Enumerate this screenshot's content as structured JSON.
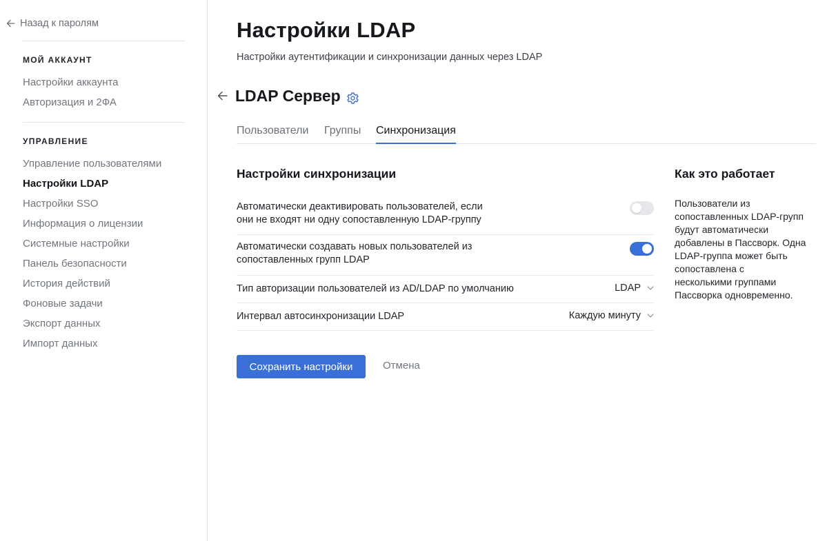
{
  "sidebar": {
    "back_label": "Назад к паролям",
    "sections": [
      {
        "title": "МОЙ АККАУНТ",
        "items": [
          {
            "label": "Настройки аккаунта"
          },
          {
            "label": "Авторизация и 2ФА"
          }
        ]
      },
      {
        "title": "УПРАВЛЕНИЕ",
        "items": [
          {
            "label": "Управление пользователями"
          },
          {
            "label": "Настройки LDAP",
            "active": true
          },
          {
            "label": "Настройки SSO"
          },
          {
            "label": "Информация о лицензии"
          },
          {
            "label": "Системные настройки"
          },
          {
            "label": "Панель безопасности"
          },
          {
            "label": "История действий"
          },
          {
            "label": "Фоновые задачи"
          },
          {
            "label": "Экспорт данных"
          },
          {
            "label": "Импорт данных"
          }
        ]
      }
    ]
  },
  "header": {
    "title": "Настройки LDAP",
    "subtitle": "Настройки аутентификации и синхронизации данных через LDAP"
  },
  "server": {
    "title": "LDAP Сервер",
    "back_icon": "arrow-left-icon",
    "settings_icon": "gear-icon"
  },
  "tabs": [
    {
      "label": "Пользователи"
    },
    {
      "label": "Группы"
    },
    {
      "label": "Синхронизация",
      "active": true
    }
  ],
  "sync": {
    "title": "Настройки синхронизации",
    "settings": [
      {
        "label_line1": "Автоматически деактивировать пользователей, если",
        "label_line2": "они не входят ни одну сопоставленную LDAP-группу",
        "control": "toggle",
        "enabled": false
      },
      {
        "label_line1": "Автоматически создавать новых пользователей из",
        "label_line2": "сопоставленных групп LDAP",
        "control": "toggle",
        "enabled": true
      },
      {
        "label": "Тип авторизации пользователей из AD/LDAP по умолчанию",
        "control": "select",
        "value": "LDAP"
      },
      {
        "label": "Интервал автосинхронизации LDAP",
        "control": "select",
        "value": "Каждую минуту"
      }
    ],
    "save_label": "Сохранить настройки",
    "cancel_label": "Отмена"
  },
  "help": {
    "title": "Как это работает",
    "lines": [
      "Пользователи из",
      "сопоставленных LDAP-групп",
      "будут автоматически",
      "добавлены в Пассворк. Одна",
      "LDAP-группа может быть",
      "сопоставлена с",
      "несколькими группами",
      "Пассворка одновременно."
    ]
  },
  "colors": {
    "accent": "#3b6fd8",
    "toggle_off": "#e5e7ea",
    "muted_text": "#70757e"
  }
}
